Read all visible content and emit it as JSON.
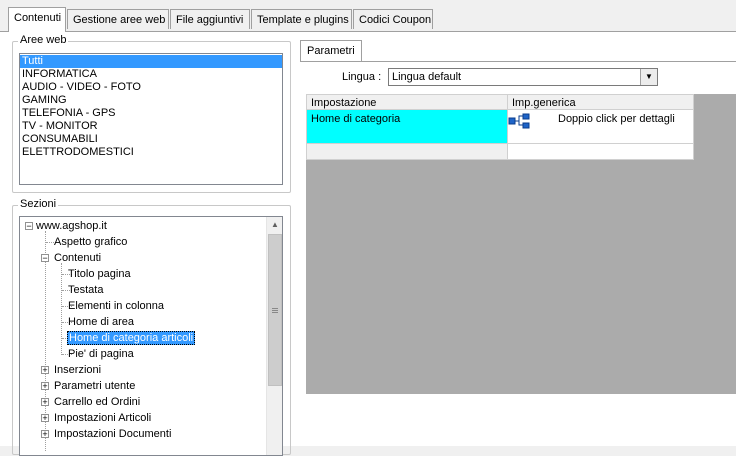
{
  "main_tabs": [
    {
      "label": "Contenuti",
      "active": true
    },
    {
      "label": "Gestione aree web",
      "active": false
    },
    {
      "label": "File aggiuntivi",
      "active": false
    },
    {
      "label": "Template e plugins",
      "active": false
    },
    {
      "label": "Codici Coupon",
      "active": false
    }
  ],
  "aree_web": {
    "legend": "Aree web",
    "items": [
      "Tutti",
      "INFORMATICA",
      "AUDIO - VIDEO - FOTO",
      "GAMING",
      "TELEFONIA - GPS",
      "TV - MONITOR",
      "CONSUMABILI",
      "ELETTRODOMESTICI"
    ],
    "selected_index": 0
  },
  "sezioni": {
    "legend": "Sezioni",
    "tree": [
      {
        "label": "www.agshop.it",
        "expander": "−"
      },
      {
        "label": "Aspetto grafico"
      },
      {
        "label": "Contenuti",
        "expander": "−"
      },
      {
        "label": "Titolo pagina"
      },
      {
        "label": "Testata"
      },
      {
        "label": "Elementi in colonna"
      },
      {
        "label": "Home di area"
      },
      {
        "label": "Home di categoria articoli",
        "selected": true
      },
      {
        "label": "Pie' di pagina"
      },
      {
        "label": "Inserzioni",
        "expander": "+"
      },
      {
        "label": "Parametri utente",
        "expander": "+"
      },
      {
        "label": "Carrello ed Ordini",
        "expander": "+"
      },
      {
        "label": "Impostazioni Articoli",
        "expander": "+"
      },
      {
        "label": "Impostazioni Documenti",
        "expander": "+"
      }
    ]
  },
  "parametri": {
    "tab_label": "Parametri",
    "lingua_label": "Lingua :",
    "lingua_value": "Lingua default",
    "columns": [
      "Impostazione",
      "Imp.generica"
    ],
    "rows": [
      {
        "impostazione": "Home di categoria",
        "generica": "Doppio click per dettagli",
        "icon": "tree-structure-icon"
      }
    ],
    "highlight_color": "#00ffff"
  }
}
